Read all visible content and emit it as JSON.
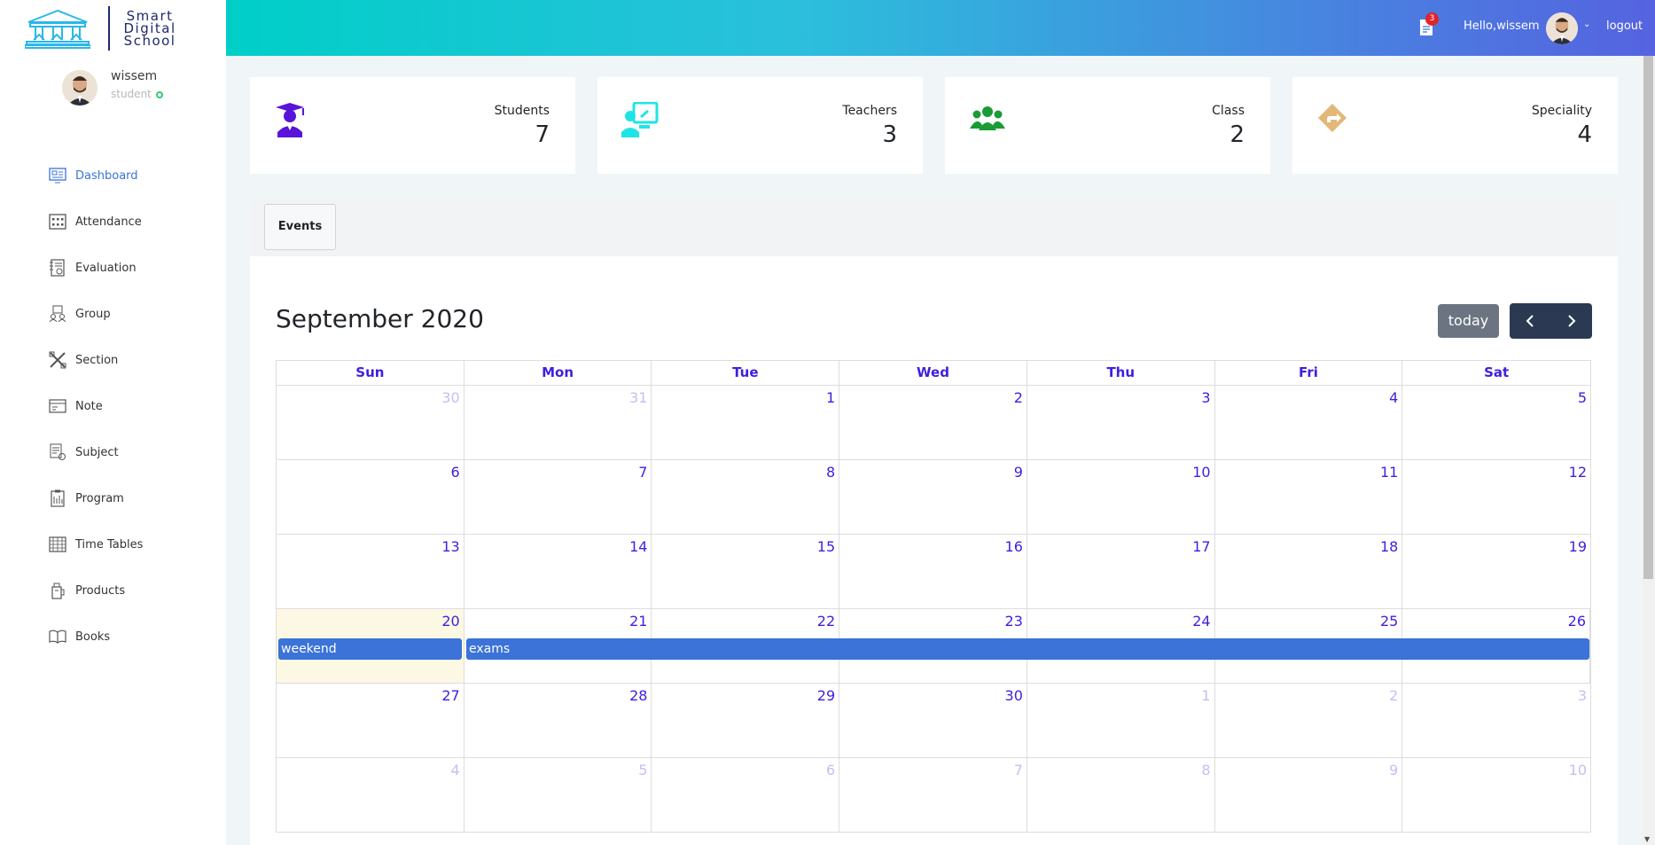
{
  "brand": {
    "line1": "Smart",
    "line2": "Digital",
    "line3": "School"
  },
  "user": {
    "name": "wissem",
    "role": "student"
  },
  "sidebar": {
    "items": [
      {
        "label": "Dashboard",
        "icon": "dashboard-icon"
      },
      {
        "label": "Attendance",
        "icon": "calendar-grid-icon"
      },
      {
        "label": "Evaluation",
        "icon": "evaluation-icon"
      },
      {
        "label": "Group",
        "icon": "group-icon"
      },
      {
        "label": "Section",
        "icon": "section-icon"
      },
      {
        "label": "Note",
        "icon": "note-card-icon"
      },
      {
        "label": "Subject",
        "icon": "subject-icon"
      },
      {
        "label": "Program",
        "icon": "program-icon"
      },
      {
        "label": "Time Tables",
        "icon": "timetable-icon"
      },
      {
        "label": "Products",
        "icon": "products-icon"
      },
      {
        "label": "Books",
        "icon": "book-icon"
      }
    ]
  },
  "topbar": {
    "notif_count": "3",
    "hello": "Hello,wissem",
    "logout": "logout"
  },
  "stats": [
    {
      "label": "Students",
      "value": "7",
      "color": "#5a14d8"
    },
    {
      "label": "Teachers",
      "value": "3",
      "color": "#1ee5e5"
    },
    {
      "label": "Class",
      "value": "2",
      "color": "#1a9b36"
    },
    {
      "label": "Speciality",
      "value": "4",
      "color": "#e3b77a"
    }
  ],
  "events": {
    "tab": "Events",
    "title": "September 2020",
    "today_label": "today",
    "weekdays": [
      "Sun",
      "Mon",
      "Tue",
      "Wed",
      "Thu",
      "Fri",
      "Sat"
    ],
    "weeks": [
      [
        "30",
        "31",
        "1",
        "2",
        "3",
        "4",
        "5"
      ],
      [
        "6",
        "7",
        "8",
        "9",
        "10",
        "11",
        "12"
      ],
      [
        "13",
        "14",
        "15",
        "16",
        "17",
        "18",
        "19"
      ],
      [
        "20",
        "21",
        "22",
        "23",
        "24",
        "25",
        "26"
      ],
      [
        "27",
        "28",
        "29",
        "30",
        "1",
        "2",
        "3"
      ],
      [
        "4",
        "5",
        "6",
        "7",
        "8",
        "9",
        "10"
      ]
    ],
    "event_weekend": "weekend",
    "event_exams": "exams"
  }
}
